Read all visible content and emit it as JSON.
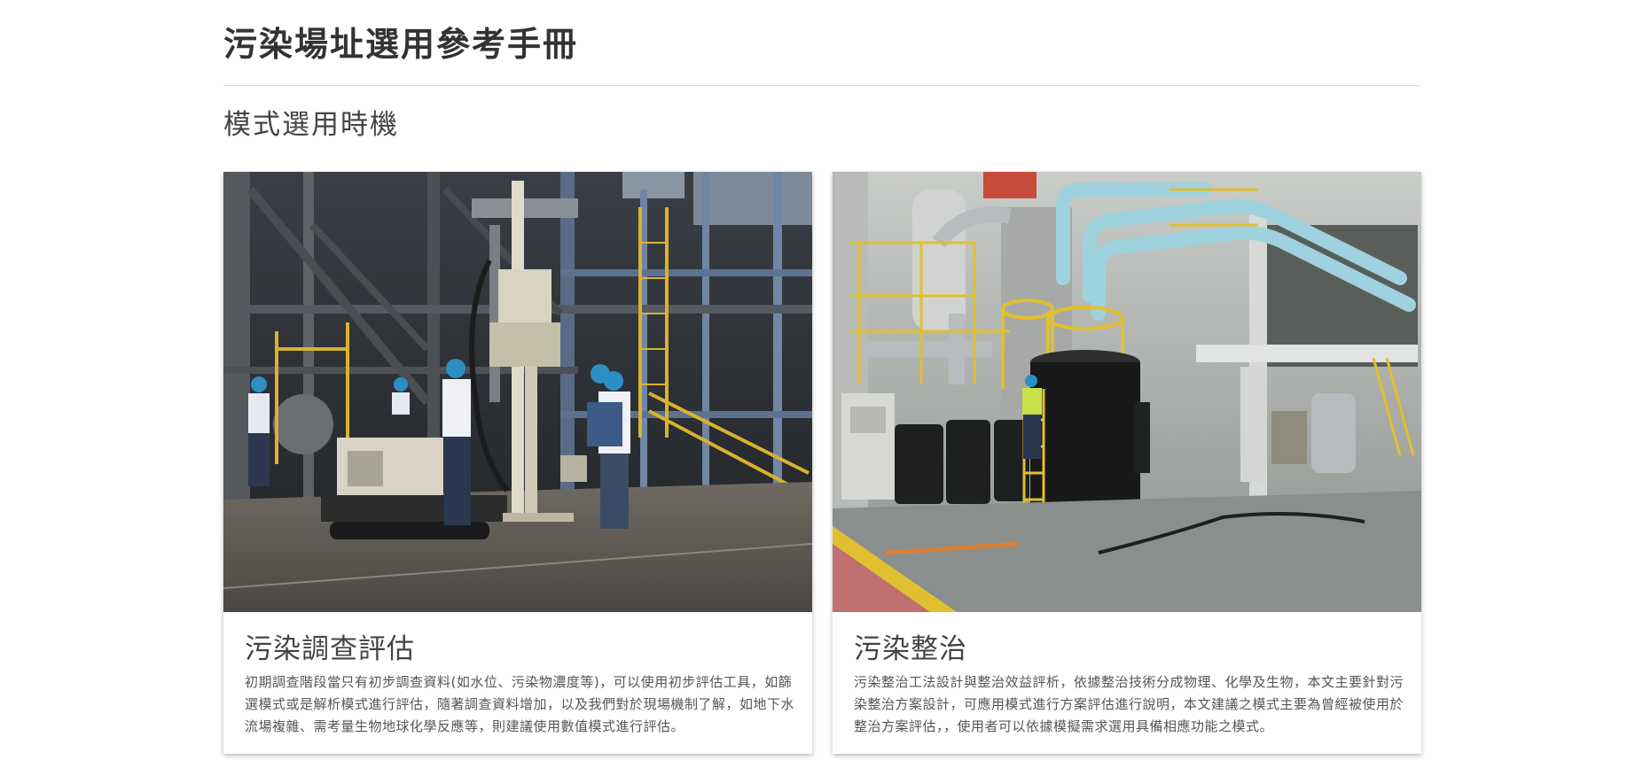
{
  "header": {
    "site_title": "污染場址選用參考手冊"
  },
  "section": {
    "heading": "模式選用時機"
  },
  "cards": [
    {
      "image_alt": "drilling rig workers",
      "title": "污染調查評估",
      "description": "初期調查階段當只有初步調查資料(如水位、污染物濃度等)，可以使用初步評估工具，如篩選模式或是解析模式進行評估，隨著調查資料增加，以及我們對於現場機制了解，如地下水流場複雜、需考量生物地球化學反應等，則建議使用數值模式進行評估。"
    },
    {
      "image_alt": "treatment plant tanks",
      "title": "污染整治",
      "description": "污染整治工法設計與整治效益評析，依據整治技術分成物理、化學及生物，本文主要針對污染整治方案設計，可應用模式進行方案評估進行說明，本文建議之模式主要為曾經被使用於整治方案評估，，使用者可以依據模擬需求選用具備相應功能之模式。"
    }
  ],
  "colors": {
    "title_text": "#333333",
    "heading_text": "#444444",
    "body_text": "#555555",
    "rule": "#dddddd",
    "card_shadow": "rgba(0,0,0,0.28)"
  }
}
